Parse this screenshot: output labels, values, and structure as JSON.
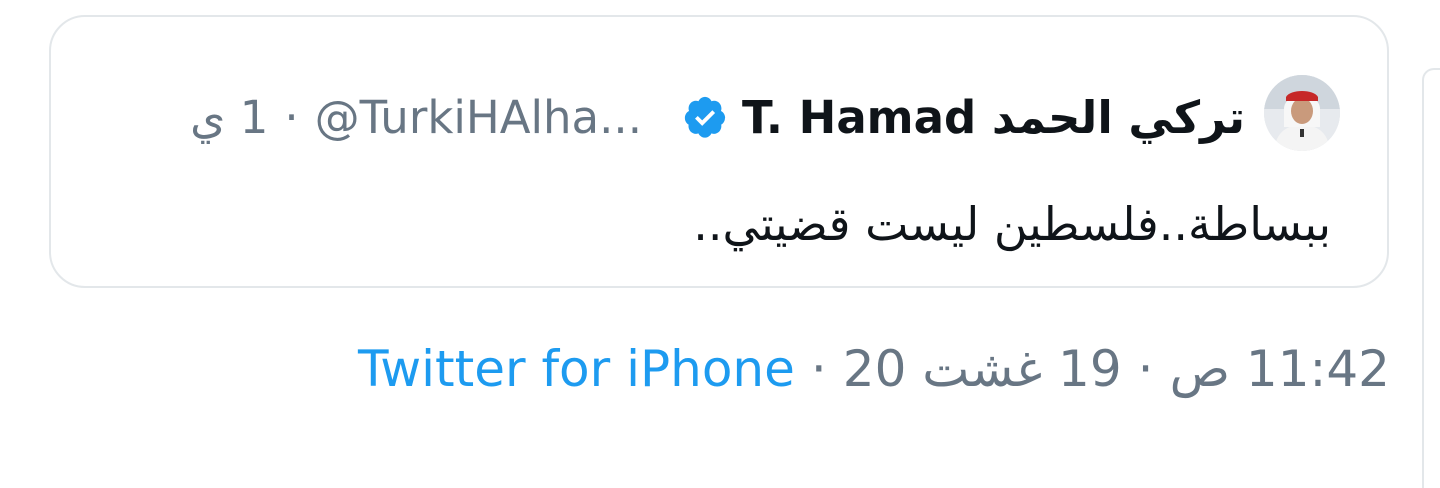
{
  "quoted_tweet": {
    "display_name": "تركي الحمد T. Hamad",
    "verified_icon": "verified-badge-icon",
    "handle": "@TurkiHAlha...",
    "separator": "·",
    "time_ago": "1 ي",
    "text": "ببساطة..فلسطين ليست قضيتي.."
  },
  "tweet_meta": {
    "time": "11:42 ص",
    "date": "19 غشت 20",
    "separator": "·",
    "source": "Twitter for iPhone"
  },
  "colors": {
    "text": "#0f1419",
    "secondary": "#687684",
    "link": "#1d9bf0",
    "verified": "#1d9bf0",
    "border": "#e3e7ea"
  }
}
